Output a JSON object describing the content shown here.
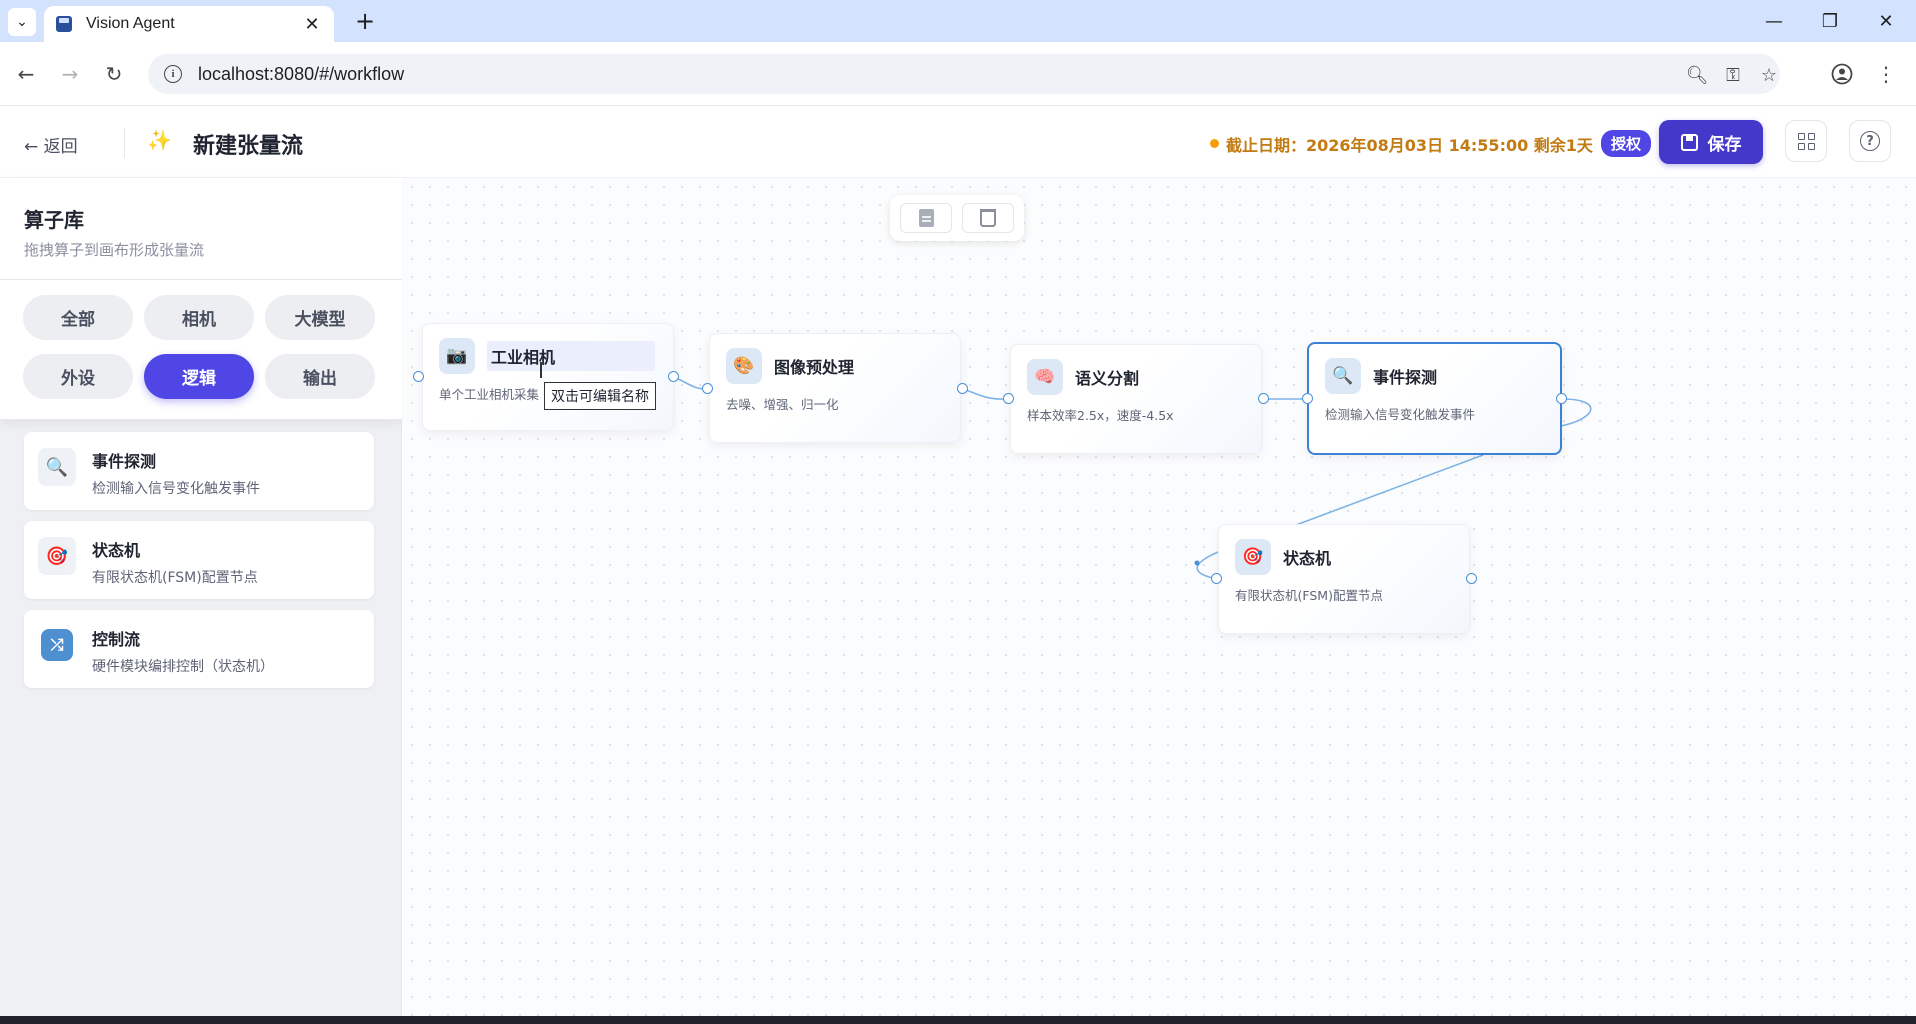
{
  "browser": {
    "tab_title": "Vision Agent",
    "url": "localhost:8080/#/workflow",
    "tab_menu_icon": "chevron-down-icon",
    "new_tab_label": "+"
  },
  "header": {
    "back_label": "← 返回",
    "flow_title": "新建张量流",
    "deadline": "截止日期：2026年08月03日 14:55:00 剩余1天",
    "auth_label": "授权",
    "save_label": "保存"
  },
  "sidebar": {
    "title": "算子库",
    "subtitle": "拖拽算子到画布形成张量流",
    "filters": [
      {
        "label": "全部",
        "active": false
      },
      {
        "label": "相机",
        "active": false
      },
      {
        "label": "大模型",
        "active": false
      },
      {
        "label": "外设",
        "active": false
      },
      {
        "label": "逻辑",
        "active": true
      },
      {
        "label": "输出",
        "active": false
      }
    ],
    "operators": [
      {
        "name": "事件探测",
        "desc": "检测输入信号变化触发事件",
        "icon": "magnifier-icon"
      },
      {
        "name": "状态机",
        "desc": "有限状态机(FSM)配置节点",
        "icon": "target-icon"
      },
      {
        "name": "控制流",
        "desc": "硬件模块编排控制（状态机）",
        "icon": "shuffle-icon"
      }
    ]
  },
  "canvas": {
    "nodes": [
      {
        "title": "工业相机",
        "desc": "单个工业相机采集",
        "icon": "camera-icon"
      },
      {
        "title": "图像预处理",
        "desc": "去噪、增强、归一化",
        "icon": "palette-icon"
      },
      {
        "title": "语义分割",
        "desc": "样本效率2.5x，速度-4.5x",
        "icon": "brain-icon"
      },
      {
        "title": "事件探测",
        "desc": "检测输入信号变化触发事件",
        "icon": "magnifier-icon"
      },
      {
        "title": "状态机",
        "desc": "有限状态机(FSM)配置节点",
        "icon": "target-icon"
      }
    ],
    "tooltip": "双击可编辑名称"
  },
  "colors": {
    "accent": "#4f46e5",
    "save_button": "#4338ca",
    "deadline_text": "#c27a13",
    "edge": "#7fb3e6",
    "selected_border": "#3b82d6"
  }
}
